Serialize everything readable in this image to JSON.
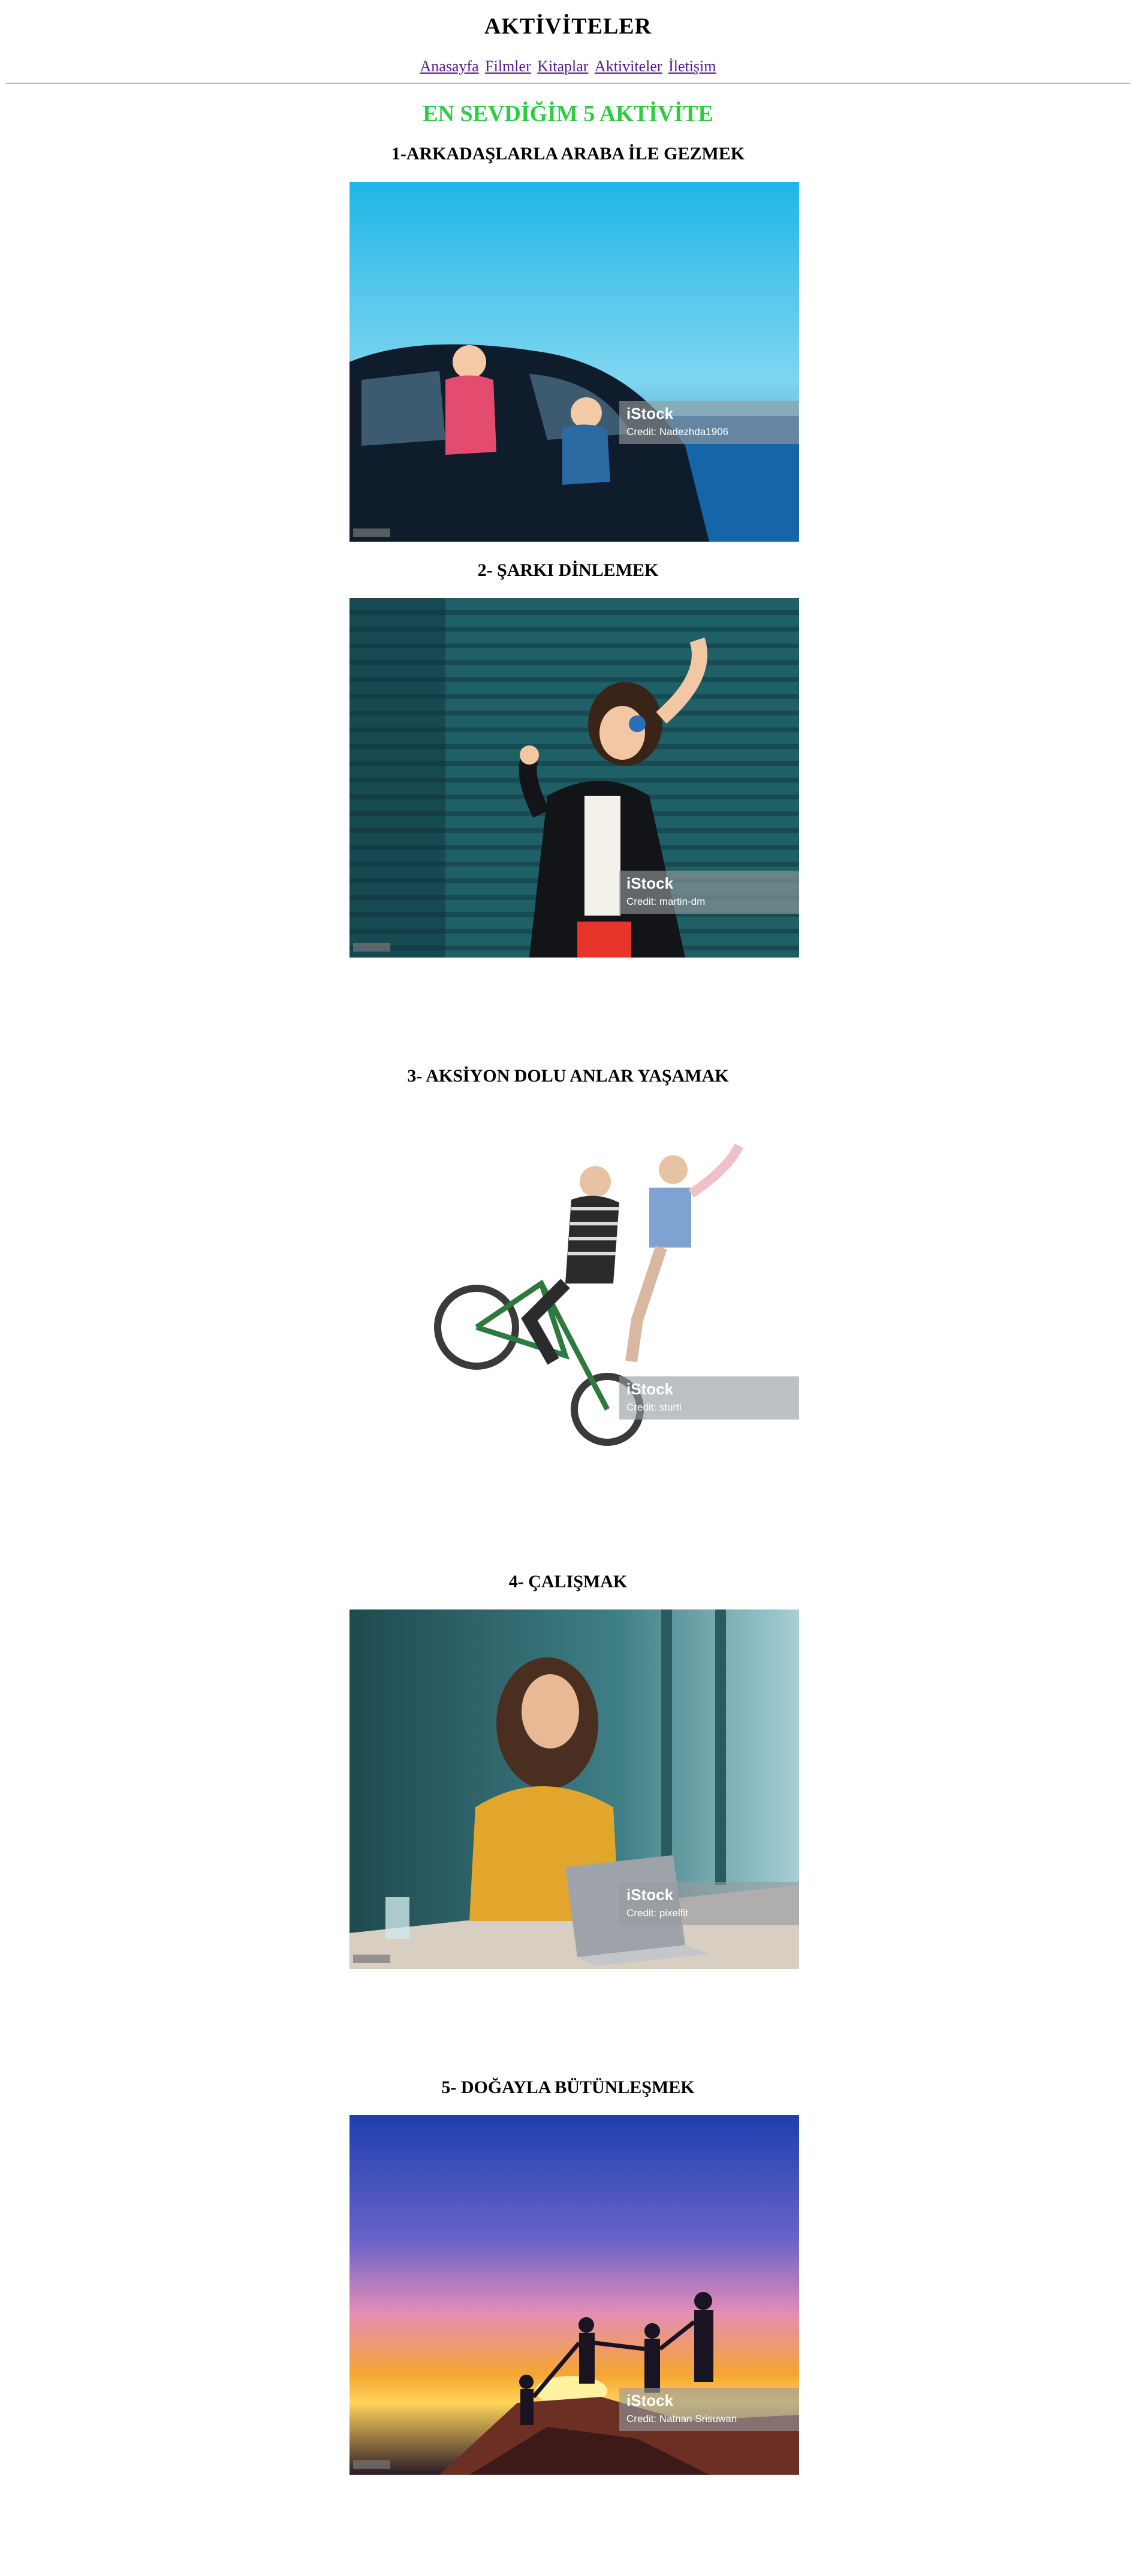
{
  "header": {
    "site_title": "AKTİVİTELER",
    "nav": [
      "Anasayfa",
      "Filmler",
      "Kitaplar",
      "Aktiviteler",
      "İletişim"
    ]
  },
  "main": {
    "heading": "EN SEVDİĞİM 5 AKTİVİTE",
    "heading_color": "#2ecc40",
    "activities": [
      {
        "title": "1-ARKADAŞLARLA ARABA İLE GEZMEK",
        "watermark": "iStock",
        "credit": "Credit: Nadezhda1906"
      },
      {
        "title": "2- ŞARKI DİNLEMEK",
        "watermark": "iStock",
        "credit": "Credit: martin-dm"
      },
      {
        "title": "3- AKSİYON DOLU ANLAR YAŞAMAK",
        "watermark": "iStock",
        "credit": "Credit: sturti"
      },
      {
        "title": "4- ÇALIŞMAK",
        "watermark": "iStock",
        "credit": "Credit: pixelfit"
      },
      {
        "title": "5- DOĞAYLA BÜTÜNLEŞMEK",
        "watermark": "iStock",
        "credit": "Credit: Natnan Srisuwan"
      }
    ]
  },
  "icons": [
    "photo-car-kids",
    "photo-music-woman",
    "photo-bike-grandmas",
    "photo-laptop-woman",
    "photo-sunset-hikers"
  ]
}
